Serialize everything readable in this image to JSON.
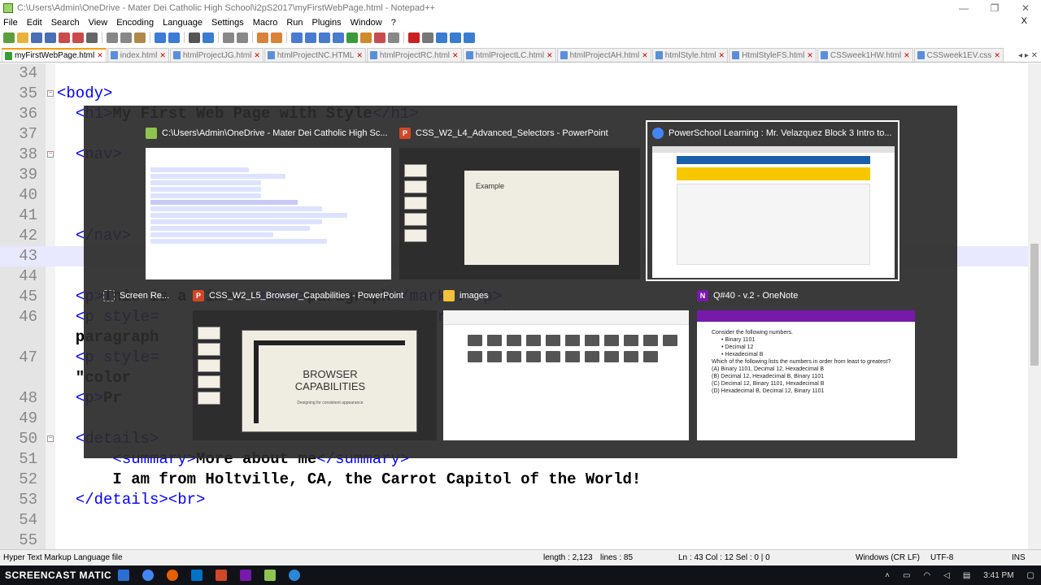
{
  "window": {
    "title": "C:\\Users\\Admin\\OneDrive - Mater Dei Catholic High School\\i2pS2017\\myFirstWebPage.html - Notepad++"
  },
  "menu": [
    "File",
    "Edit",
    "Search",
    "View",
    "Encoding",
    "Language",
    "Settings",
    "Macro",
    "Run",
    "Plugins",
    "Window",
    "?"
  ],
  "menu_close": "X",
  "tabs": [
    {
      "label": "myFirstWebPage.html",
      "active": true
    },
    {
      "label": "index.html"
    },
    {
      "label": "htmlProjectJG.html"
    },
    {
      "label": "htmlProjectNC.HTML"
    },
    {
      "label": "htmlProjectRC.html"
    },
    {
      "label": "htmlProjectLC.html"
    },
    {
      "label": "htmlProjectAH.html"
    },
    {
      "label": "htmlStyle.html"
    },
    {
      "label": "HtmlStyleFS.html"
    },
    {
      "label": "CSSweek1HW.html"
    },
    {
      "label": "CSSweek1EV.css"
    }
  ],
  "editor_lines": [
    {
      "n": "34",
      "text": ""
    },
    {
      "n": "35",
      "text": "<body>",
      "fold": true
    },
    {
      "n": "36",
      "text": "  <h1>My First Web Page with Style</h1>"
    },
    {
      "n": "37",
      "text": ""
    },
    {
      "n": "38",
      "text": "  <nav>",
      "fold": true
    },
    {
      "n": "39",
      "text": ""
    },
    {
      "n": "40",
      "text": ""
    },
    {
      "n": "41",
      "text": ""
    },
    {
      "n": "42",
      "text": "  </nav>"
    },
    {
      "n": "43",
      "text": ""
    },
    {
      "n": "44",
      "text": ""
    },
    {
      "n": "45",
      "text": "  <p>This is a Times <mark>paragraph</mark>.</p>"
    },
    {
      "n": "46",
      "text": "  <p style=                         \"color:green\">"
    },
    {
      "n": "",
      "text": "  paragraph"
    },
    {
      "n": "47",
      "text": "  <p style="
    },
    {
      "n": "",
      "text": "  \"color"
    },
    {
      "n": "48",
      "text": "  <p>Pr"
    },
    {
      "n": "49",
      "text": ""
    },
    {
      "n": "50",
      "text": "  <details>",
      "fold": true
    },
    {
      "n": "51",
      "text": "      <summary>More about me</summary>"
    },
    {
      "n": "52",
      "text": "      I am from Holtville, CA, the Carrot Capitol of the World!"
    },
    {
      "n": "53",
      "text": "  </details><br>"
    },
    {
      "n": "54",
      "text": ""
    },
    {
      "n": "55",
      "text": ""
    }
  ],
  "status": {
    "file_type": "Hyper Text Markup Language file",
    "length": "length : 2,123",
    "lines": "lines : 85",
    "position": "Ln : 43    Col : 12    Sel : 0 | 0",
    "eol": "Windows (CR LF)",
    "encoding": "UTF-8",
    "mode": "INS"
  },
  "switcher": {
    "cards": [
      {
        "title": "C:\\Users\\Admin\\OneDrive - Mater Dei Catholic High Sc...",
        "icon": "notepadpp-icon",
        "color": "#8ec450"
      },
      {
        "title": "CSS_W2_L4_Advanced_Selectors - PowerPoint",
        "icon": "powerpoint-icon",
        "color": "#d24726",
        "slide_text": "Example"
      },
      {
        "title": "PowerSchool Learning : Mr. Velazquez Block 3 Intro to...",
        "icon": "chrome-icon",
        "color": "#4285f4"
      },
      {
        "title": "Screen Re...",
        "icon": "screen-recorder-icon",
        "color": "#777777"
      },
      {
        "title": "CSS_W2_L5_Browser_Capabilities - PowerPoint",
        "icon": "powerpoint-icon",
        "color": "#d24726",
        "slide_text": "BROWSER CAPABILITIES",
        "slide_sub": "Designing for consistent appearance"
      },
      {
        "title": "images",
        "icon": "folder-icon",
        "color": "#f3c13a"
      },
      {
        "title": "Q#40 - v.2 - OneNote",
        "icon": "onenote-icon",
        "color": "#7719aa",
        "note_lines": [
          "Consider the following numbers.",
          "• Binary 1101",
          "• Decimal 12",
          "• Hexadecimal B",
          "Which of the following lists the numbers in order from least to greatest?",
          "(A) Binary 1101, Decimal 12, Hexadecimal B",
          "(B) Decimal 12, Hexadecimal B, Binary 1101",
          "(C) Decimal 12, Binary 1101, Hexadecimal B",
          "(D) Hexadecimal B, Decimal 12, Binary 1101"
        ]
      }
    ]
  },
  "taskbar": {
    "watermark": "SCREENCAST MATIC",
    "clock": "3:41 PM"
  }
}
